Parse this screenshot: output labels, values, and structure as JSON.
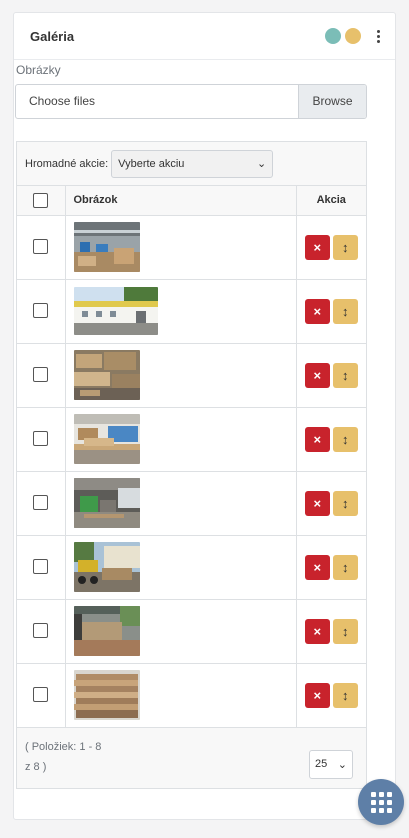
{
  "card": {
    "title": "Galéria",
    "status_dots": [
      "#7bbdb7",
      "#e7c06b"
    ],
    "menu_icon": "kebab-vertical-icon"
  },
  "upload": {
    "label": "Obrázky",
    "placeholder": "Choose files",
    "browse_label": "Browse"
  },
  "bulk": {
    "label": "Hromadné akcie:",
    "selected": "Vyberte akciu"
  },
  "table": {
    "columns": [
      "",
      "Obrázok",
      "Akcia"
    ],
    "rows": [
      {
        "thumb": "warehouse-interior",
        "delete_icon": "×",
        "move_icon": "↕"
      },
      {
        "thumb": "building-exterior",
        "delete_icon": "×",
        "move_icon": "↕"
      },
      {
        "thumb": "wood-pallets",
        "delete_icon": "×",
        "move_icon": "↕"
      },
      {
        "thumb": "workshop-lumber",
        "delete_icon": "×",
        "move_icon": "↕"
      },
      {
        "thumb": "factory-machines",
        "delete_icon": "×",
        "move_icon": "↕"
      },
      {
        "thumb": "forklift-yard",
        "delete_icon": "×",
        "move_icon": "↕"
      },
      {
        "thumb": "shed-lumber",
        "delete_icon": "×",
        "move_icon": "↕"
      },
      {
        "thumb": "stacked-planks",
        "delete_icon": "×",
        "move_icon": "↕"
      }
    ]
  },
  "pagination": {
    "info_line1": "( Položiek: 1 - 8",
    "info_line2": "z 8 )",
    "per_page": "25"
  },
  "colors": {
    "delete": "#c8232c",
    "move": "#e7c06b",
    "fab": "#5e7fa7"
  },
  "fab": {
    "icon": "grid-apps-icon"
  }
}
